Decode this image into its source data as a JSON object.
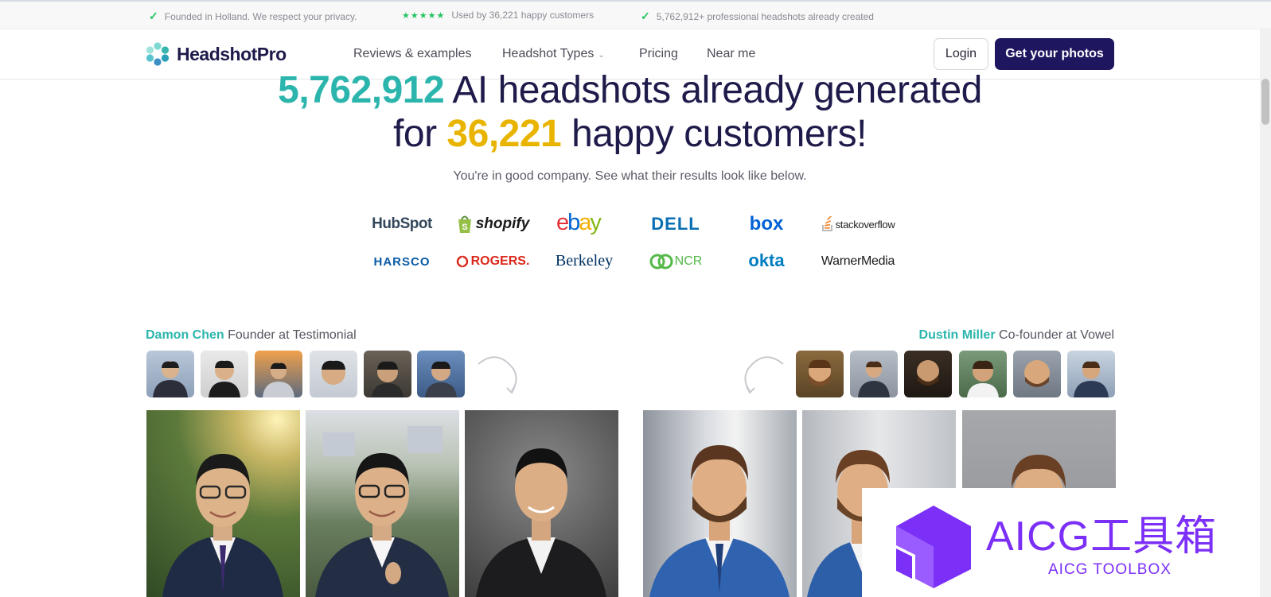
{
  "topbar": {
    "items": [
      {
        "icon": "check-icon",
        "text": "Founded in Holland. We respect your privacy."
      },
      {
        "icon": "five-stars-icon",
        "stars": 5,
        "text": "Used by 36,221 happy customers"
      },
      {
        "icon": "check-icon",
        "text": "5,762,912+ professional headshots already created"
      }
    ]
  },
  "nav": {
    "brand": "HeadshotPro",
    "links": [
      "Reviews & examples",
      "Headshot Types",
      "Pricing",
      "Near me"
    ],
    "login": "Login",
    "cta": "Get your photos"
  },
  "hero": {
    "count": "5,762,912",
    "line1_rest": " AI headshots already generated",
    "line2_start": "for ",
    "customers": "36,221",
    "line2_rest": " happy customers!",
    "subtitle": "You're in good company. See what their results look like below."
  },
  "logos": {
    "row1": [
      "HubSpot",
      "shopify",
      "ebay",
      "DELL",
      "box",
      "stackoverflow"
    ],
    "row2": [
      "HARSCO",
      "ROGERS.",
      "Berkeley",
      "NCR",
      "okta",
      "WarnerMedia"
    ]
  },
  "testimonials": [
    {
      "name": "Damon Chen",
      "role": "Founder at Testimonial"
    },
    {
      "name": "Dustin Miller",
      "role": "Co-founder at Vowel"
    }
  ],
  "watermark": {
    "title": "AICG工具箱",
    "subtitle": "AICG TOOLBOX"
  },
  "colors": {
    "brand_navy": "#1e1760",
    "teal": "#2bb5ad",
    "gold": "#e8b400",
    "check_green": "#22c55e",
    "watermark_purple": "#7b2ff7"
  }
}
